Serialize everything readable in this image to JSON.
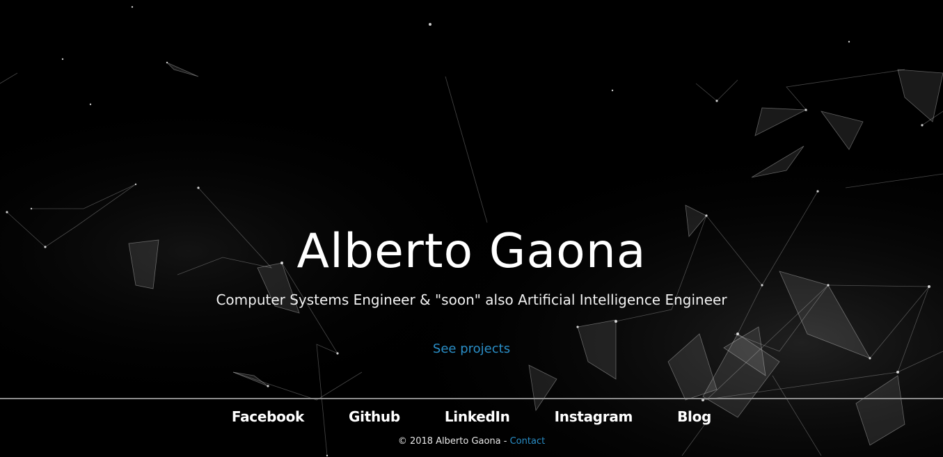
{
  "hero": {
    "title": "Alberto Gaona",
    "subtitle": "Computer Systems Engineer & \"soon\" also Artificial Intelligence Engineer",
    "cta_label": "See projects"
  },
  "social": {
    "links": [
      {
        "label": "Facebook"
      },
      {
        "label": "Github"
      },
      {
        "label": "LinkedIn"
      },
      {
        "label": "Instagram"
      },
      {
        "label": "Blog"
      }
    ]
  },
  "footer": {
    "copyright": "© 2018 Alberto Gaona -",
    "contact_label": "Contact"
  },
  "colors": {
    "background": "#000000",
    "accent": "#2a8fc8",
    "text": "#ffffff",
    "divider": "#8d8d8d"
  }
}
